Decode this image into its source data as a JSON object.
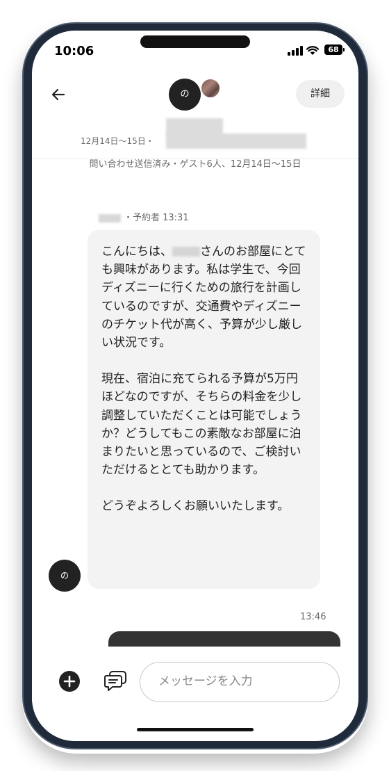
{
  "status_bar": {
    "time": "10:06",
    "battery": "68"
  },
  "header": {
    "host_avatar_initial": "の",
    "details_label": "詳細",
    "dates": "12月14日〜15日・"
  },
  "inquiry": {
    "status_text": "問い合わせ送信済み・ゲスト6人、12月14日〜15日"
  },
  "message": {
    "sender_meta": "・予約者 13:31",
    "avatar_initial": "の",
    "greeting_prefix": "こんにちは、",
    "paragraph1_rest": "さんのお部屋にとても興味があります。私は学生で、今回ディズニーに行くための旅行を計画しているのですが、交通費やディズニーのチケット代が高く、予算が少し厳しい状況です。",
    "paragraph2": "現在、宿泊に充てられる予算が5万円ほどなのですが、そちらの料金を少し調整していただくことは可能でしょうか？どうしてもこの素敵なお部屋に泊まりたいと思っているので、ご検討いただけるととても助かります。",
    "paragraph3": "どうぞよろしくお願いいたします。"
  },
  "next_message": {
    "time": "13:46"
  },
  "composer": {
    "placeholder": "メッセージを入力"
  }
}
